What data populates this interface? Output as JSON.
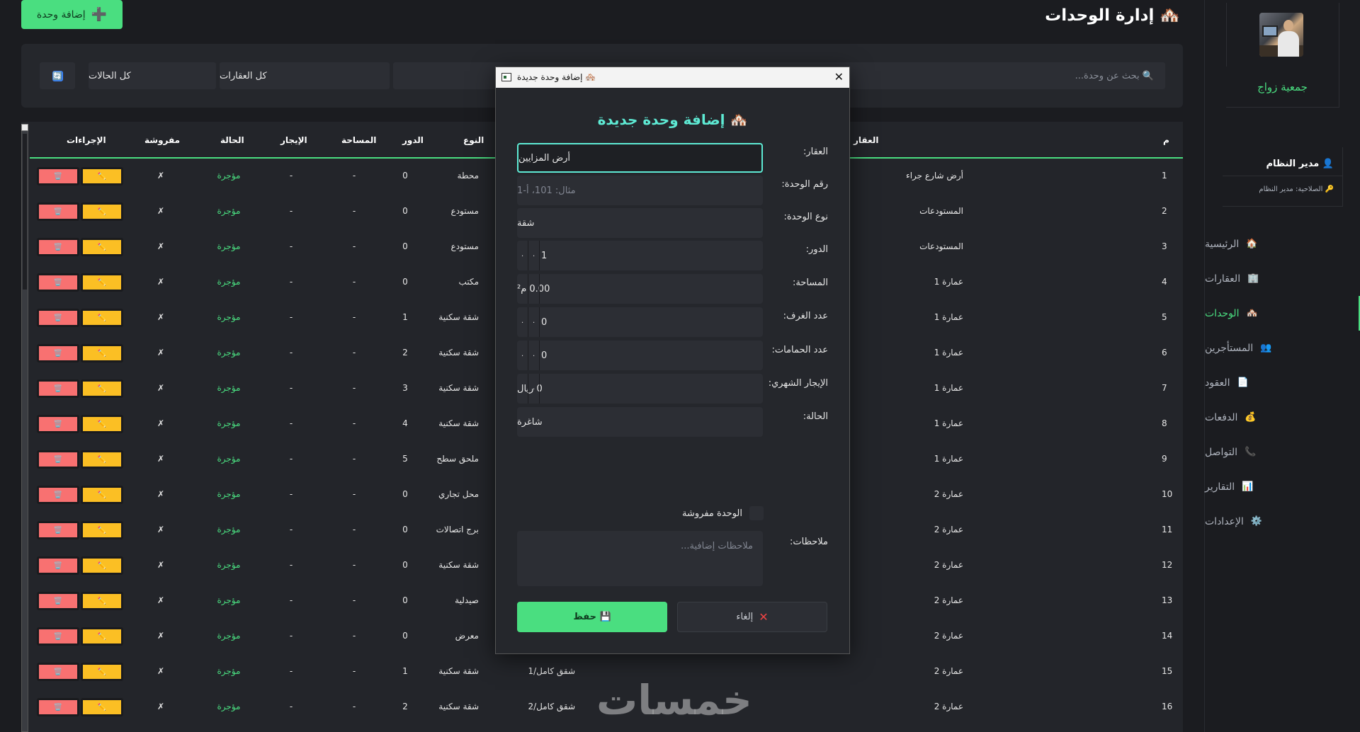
{
  "header": {
    "title": "🏘️ إدارة الوحدات",
    "add_button_label": "إضافة وحدة",
    "add_button_icon": "➕"
  },
  "filters": {
    "search_placeholder": "🔍 بحث عن وحدة...",
    "property_filter": "كل العقارات",
    "status_filter": "كل الحالات",
    "refresh_icon": "🔄"
  },
  "sidebar": {
    "association": "جمعية زواج",
    "user_name": "👤 مدير النظام",
    "user_role": "🔑 الصلاحية: مدير النظام",
    "items": [
      {
        "label": "الرئيسية",
        "icon": "🏠"
      },
      {
        "label": "العقارات",
        "icon": "🏢"
      },
      {
        "label": "الوحدات",
        "icon": "🏘️"
      },
      {
        "label": "المستأجرين",
        "icon": "👥"
      },
      {
        "label": "العقود",
        "icon": "📄"
      },
      {
        "label": "الدفعات",
        "icon": "💰"
      },
      {
        "label": "التواصل",
        "icon": "📞"
      },
      {
        "label": "التقارير",
        "icon": "📊"
      },
      {
        "label": "الإعدادات",
        "icon": "⚙️"
      }
    ]
  },
  "table": {
    "columns": {
      "num": "م",
      "property": "العقار",
      "type": "النوع",
      "floor": "الدور",
      "area": "المساحة",
      "rent": "الإيجار",
      "status": "الحالة",
      "furnished": "مفروشة",
      "actions": "الإجراءات"
    },
    "edit_icon": "✏️",
    "delete_icon": "🗑️",
    "rows": [
      {
        "num": "1",
        "property": "أرض شارع جراء",
        "unit": "",
        "type": "محطة",
        "floor": "0",
        "area": "-",
        "rent": "-",
        "status": "مؤجرة",
        "furnished": "✗"
      },
      {
        "num": "2",
        "property": "المستودعات",
        "unit": "",
        "type": "مستودع",
        "floor": "0",
        "area": "-",
        "rent": "-",
        "status": "مؤجرة",
        "furnished": "✗"
      },
      {
        "num": "3",
        "property": "المستودعات",
        "unit": "",
        "type": "مستودع",
        "floor": "0",
        "area": "-",
        "rent": "-",
        "status": "مؤجرة",
        "furnished": "✗"
      },
      {
        "num": "4",
        "property": "عمارة 1",
        "unit": "",
        "type": "مكتب",
        "floor": "0",
        "area": "-",
        "rent": "-",
        "status": "مؤجرة",
        "furnished": "✗"
      },
      {
        "num": "5",
        "property": "عمارة 1",
        "unit": "",
        "type": "شقة سكنية",
        "floor": "1",
        "area": "-",
        "rent": "-",
        "status": "مؤجرة",
        "furnished": "✗"
      },
      {
        "num": "6",
        "property": "عمارة 1",
        "unit": "",
        "type": "شقة سكنية",
        "floor": "2",
        "area": "-",
        "rent": "-",
        "status": "مؤجرة",
        "furnished": "✗"
      },
      {
        "num": "7",
        "property": "عمارة 1",
        "unit": "",
        "type": "شقة سكنية",
        "floor": "3",
        "area": "-",
        "rent": "-",
        "status": "مؤجرة",
        "furnished": "✗"
      },
      {
        "num": "8",
        "property": "عمارة 1",
        "unit": "",
        "type": "شقة سكنية",
        "floor": "4",
        "area": "-",
        "rent": "-",
        "status": "مؤجرة",
        "furnished": "✗"
      },
      {
        "num": "9",
        "property": "عمارة 1",
        "unit": "",
        "type": "ملحق سطح",
        "floor": "5",
        "area": "-",
        "rent": "-",
        "status": "مؤجرة",
        "furnished": "✗"
      },
      {
        "num": "10",
        "property": "عمارة 2",
        "unit": "",
        "type": "محل تجاري",
        "floor": "0",
        "area": "-",
        "rent": "-",
        "status": "مؤجرة",
        "furnished": "✗"
      },
      {
        "num": "11",
        "property": "عمارة 2",
        "unit": "",
        "type": "برج اتصالات",
        "floor": "0",
        "area": "-",
        "rent": "-",
        "status": "مؤجرة",
        "furnished": "✗"
      },
      {
        "num": "12",
        "property": "عمارة 2",
        "unit": "",
        "type": "شقة سكنية",
        "floor": "0",
        "area": "-",
        "rent": "-",
        "status": "مؤجرة",
        "furnished": "✗"
      },
      {
        "num": "13",
        "property": "عمارة 2",
        "unit": "",
        "type": "صيدلية",
        "floor": "0",
        "area": "-",
        "rent": "-",
        "status": "مؤجرة",
        "furnished": "✗"
      },
      {
        "num": "14",
        "property": "عمارة 2",
        "unit": "",
        "type": "معرض",
        "floor": "0",
        "area": "-",
        "rent": "-",
        "status": "مؤجرة",
        "furnished": "✗"
      },
      {
        "num": "15",
        "property": "عمارة 2",
        "unit": "شقق كامل/1",
        "type": "شقة سكنية",
        "floor": "1",
        "area": "-",
        "rent": "-",
        "status": "مؤجرة",
        "furnished": "✗"
      },
      {
        "num": "16",
        "property": "عمارة 2",
        "unit": "شقق كامل/2",
        "type": "شقة سكنية",
        "floor": "2",
        "area": "-",
        "rent": "-",
        "status": "مؤجرة",
        "furnished": "✗"
      }
    ]
  },
  "dialog": {
    "window_title": "🏘️ إضافة وحدة جديدة",
    "heading": "🏘️ إضافة وحدة جديدة",
    "close_icon": "✕",
    "fields": {
      "property_label": "العقار:",
      "property_value": "أرض المزايين",
      "unit_number_label": "رقم الوحدة:",
      "unit_number_placeholder": "مثال: 101، أ-1",
      "unit_type_label": "نوع الوحدة:",
      "unit_type_value": "شقة",
      "floor_label": "الدور:",
      "floor_value": "1",
      "area_label": "المساحة:",
      "area_value": "0.00 م²",
      "rooms_label": "عدد الغرف:",
      "rooms_value": "0",
      "bathrooms_label": "عدد الحمامات:",
      "bathrooms_value": "0",
      "rent_label": "الإيجار الشهري:",
      "rent_value": "0 ريال",
      "status_label": "الحالة:",
      "status_value": "شاغرة",
      "furnished_label": "الوحدة مفروشة",
      "notes_label": "ملاحظات:",
      "notes_placeholder": "ملاحظات إضافية..."
    },
    "spin_glyph": "٠",
    "save_label": "💾 حفظ",
    "cancel_label": "إلغاء",
    "cancel_icon": "✕"
  },
  "watermark": "خمسات"
}
